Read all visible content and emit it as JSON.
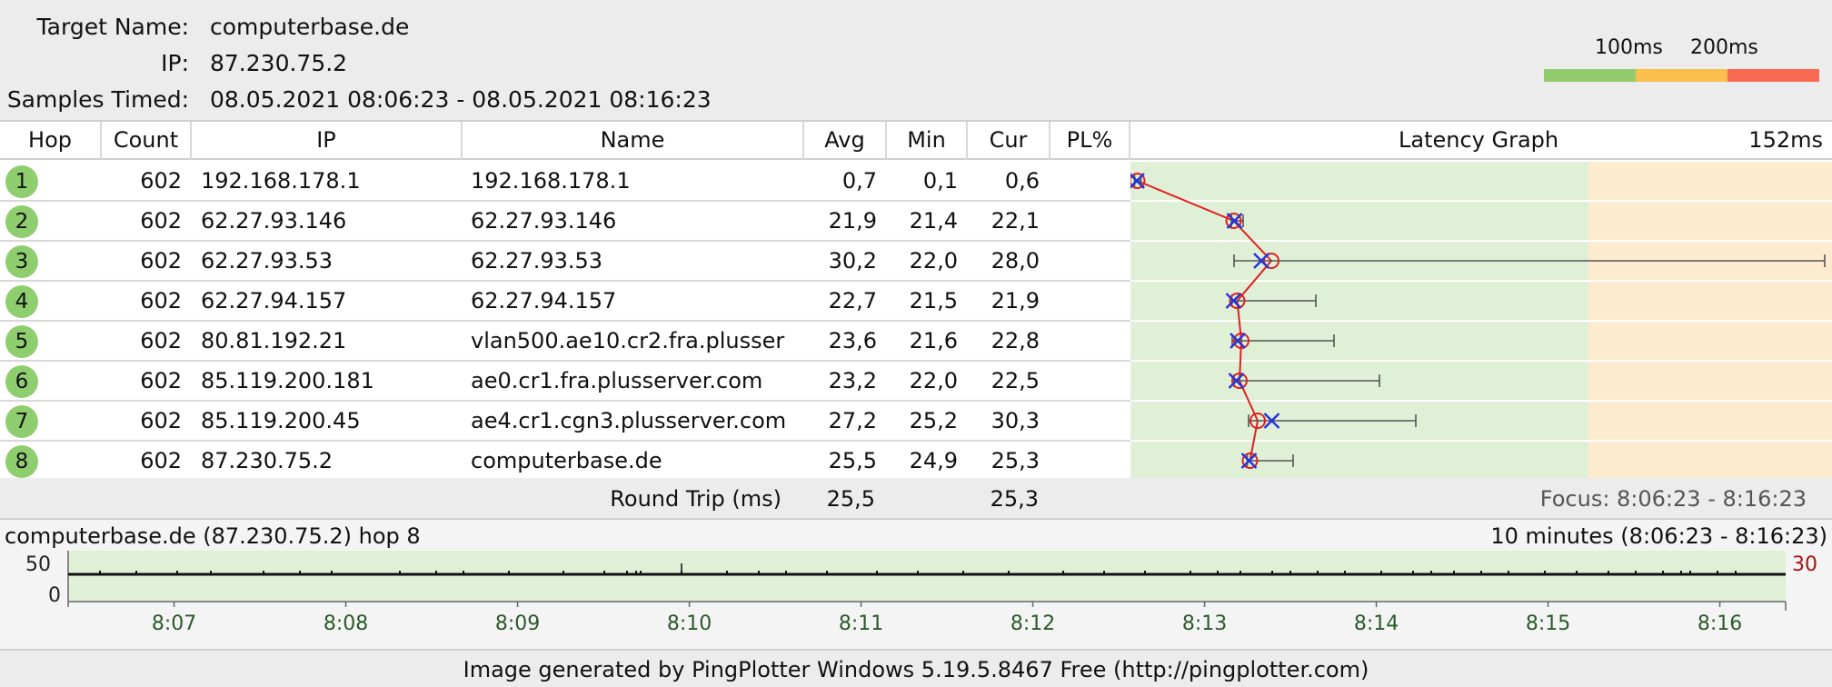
{
  "header": {
    "target_label": "Target Name:",
    "target_value": "computerbase.de",
    "ip_label": "IP:",
    "ip_value": "87.230.75.2",
    "samples_label": "Samples Timed:",
    "samples_value": "08.05.2021 08:06:23 - 08.05.2021 08:16:23",
    "scale_100": "100ms",
    "scale_200": "200ms"
  },
  "colors": {
    "good": "#92cc6f",
    "warn": "#fbbf4b",
    "bad": "#f76a52",
    "graph_green": "#dff0d6",
    "graph_orange": "#fdebcf",
    "hop_dot": "#8fce6e"
  },
  "table": {
    "columns": [
      "Hop",
      "Count",
      "IP",
      "Name",
      "Avg",
      "Min",
      "Cur",
      "PL%",
      "Latency Graph"
    ],
    "graph_max": "152ms",
    "rows": [
      {
        "hop": "1",
        "count": "602",
        "ip": "192.168.178.1",
        "name": "192.168.178.1",
        "avg": "0,7",
        "min": "0,1",
        "cur": "0,6",
        "pl": ""
      },
      {
        "hop": "2",
        "count": "602",
        "ip": "62.27.93.146",
        "name": "62.27.93.146",
        "avg": "21,9",
        "min": "21,4",
        "cur": "22,1",
        "pl": ""
      },
      {
        "hop": "3",
        "count": "602",
        "ip": "62.27.93.53",
        "name": "62.27.93.53",
        "avg": "30,2",
        "min": "22,0",
        "cur": "28,0",
        "pl": ""
      },
      {
        "hop": "4",
        "count": "602",
        "ip": "62.27.94.157",
        "name": "62.27.94.157",
        "avg": "22,7",
        "min": "21,5",
        "cur": "21,9",
        "pl": ""
      },
      {
        "hop": "5",
        "count": "602",
        "ip": "80.81.192.21",
        "name": "vlan500.ae10.cr2.fra.plusser",
        "avg": "23,6",
        "min": "21,6",
        "cur": "22,8",
        "pl": ""
      },
      {
        "hop": "6",
        "count": "602",
        "ip": "85.119.200.181",
        "name": "ae0.cr1.fra.plusserver.com",
        "avg": "23,2",
        "min": "22,0",
        "cur": "22,5",
        "pl": ""
      },
      {
        "hop": "7",
        "count": "602",
        "ip": "85.119.200.45",
        "name": "ae4.cr1.cgn3.plusserver.com",
        "avg": "27,2",
        "min": "25,2",
        "cur": "30,3",
        "pl": ""
      },
      {
        "hop": "8",
        "count": "602",
        "ip": "87.230.75.2",
        "name": "computerbase.de",
        "avg": "25,5",
        "min": "24,9",
        "cur": "25,3",
        "pl": ""
      }
    ],
    "latency": [
      {
        "avg": 0.7,
        "min": 0.1,
        "max": 1.5,
        "cur": 0.6
      },
      {
        "avg": 21.9,
        "min": 21.4,
        "max": 24.0,
        "cur": 22.1
      },
      {
        "avg": 30.2,
        "min": 22.0,
        "max": 152.0,
        "cur": 28.0
      },
      {
        "avg": 22.7,
        "min": 21.5,
        "max": 40.0,
        "cur": 21.9
      },
      {
        "avg": 23.6,
        "min": 21.6,
        "max": 44.0,
        "cur": 22.8
      },
      {
        "avg": 23.2,
        "min": 22.0,
        "max": 54.0,
        "cur": 22.5
      },
      {
        "avg": 27.2,
        "min": 25.2,
        "max": 62.0,
        "cur": 30.3
      },
      {
        "avg": 25.5,
        "min": 24.9,
        "max": 35.0,
        "cur": 25.3
      }
    ]
  },
  "round_trip": {
    "label": "Round Trip (ms)",
    "avg": "25,5",
    "cur": "25,3",
    "focus": "Focus: 8:06:23 - 8:16:23"
  },
  "timeline": {
    "title": "computerbase.de (87.230.75.2) hop 8",
    "range": "10 minutes (8:06:23 - 8:16:23)",
    "y_top": "50",
    "y_bottom": "0",
    "scale_max": "30",
    "ticks": [
      "8:07",
      "8:08",
      "8:09",
      "8:10",
      "8:11",
      "8:12",
      "8:13",
      "8:14",
      "8:15",
      "8:16"
    ]
  },
  "footer": "Image generated by PingPlotter Windows 5.19.5.8467 Free (http://pingplotter.com)"
}
